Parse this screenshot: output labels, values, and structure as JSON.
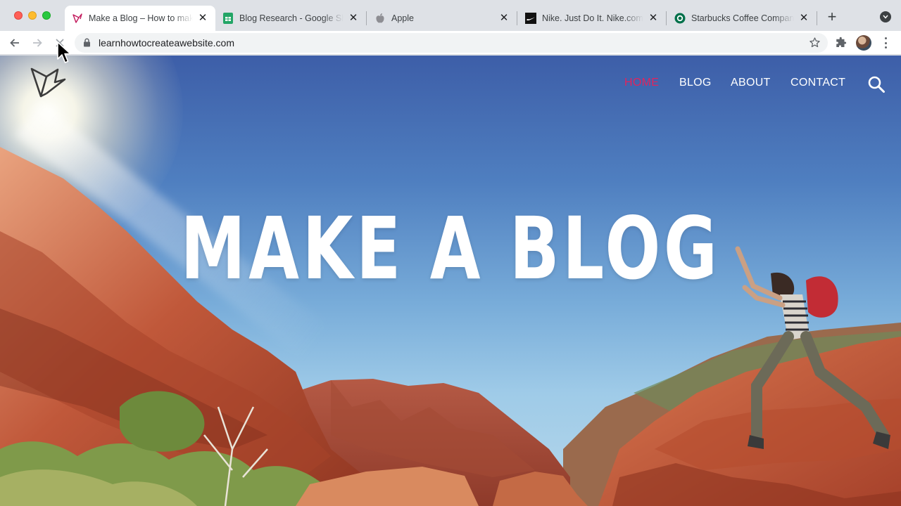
{
  "browser": {
    "tabs": [
      {
        "title": "Make a Blog – How to make a Blog",
        "favicon": "bird-logo-icon",
        "active": true
      },
      {
        "title": "Blog Research - Google Sheets",
        "favicon": "google-sheets-icon",
        "active": false
      },
      {
        "title": "Apple",
        "favicon": "apple-icon",
        "active": false
      },
      {
        "title": "Nike. Just Do It. Nike.com",
        "favicon": "nike-icon",
        "active": false
      },
      {
        "title": "Starbucks Coffee Company",
        "favicon": "starbucks-icon",
        "active": false
      }
    ],
    "url": "learnhowtocreateawebsite.com"
  },
  "site": {
    "nav": [
      {
        "label": "HOME",
        "active": true
      },
      {
        "label": "BLOG",
        "active": false
      },
      {
        "label": "ABOUT",
        "active": false
      },
      {
        "label": "CONTACT",
        "active": false
      }
    ],
    "hero_title": "MAKE A BLOG"
  },
  "colors": {
    "nav_active": "#e0245e",
    "nav_text": "#ffffff",
    "tabstrip_bg": "#dee1e6"
  }
}
